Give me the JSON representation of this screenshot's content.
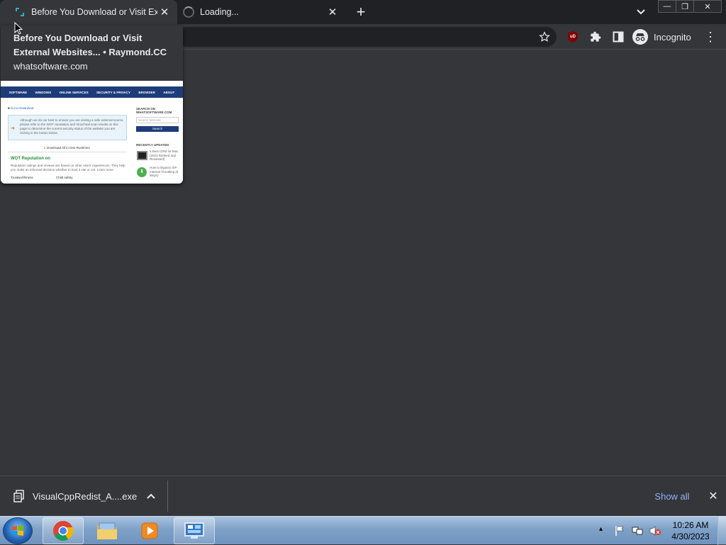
{
  "tabs": [
    {
      "title": "Before You Download or Visit External Websites... • Raymond.CC",
      "close_glyph": "✕"
    },
    {
      "title": "Loading...",
      "close_glyph": "✕"
    }
  ],
  "new_tab_glyph": "+",
  "tab_search_glyph": "⌄",
  "window_controls": {
    "minimize": "—",
    "restore": "❐",
    "close": "✕"
  },
  "toolbar": {
    "bookmark_icon": "star-icon",
    "incognito_label": "Incognito",
    "menu_glyph": "⋮",
    "ublock_label": "uD"
  },
  "hover_card": {
    "title": "Before You Download or Visit External Websites... • Raymond.CC",
    "domain": "whatsoftware.com",
    "preview": {
      "nav": [
        "SOFTWARE",
        "WINDOWS",
        "ONLINE SERVICES",
        "SECURITY & PRIVACY",
        "BROWSER",
        "ABOUT"
      ],
      "breadcrumb": "■ Go to Download",
      "note": "Although we do our best to ensure you are visiting a safe external source, please refer to the WOT reputation and VirusTotal scan results on this page to determine the current security status of the website you are visiting in the button below.",
      "download_link": "⇩ Download All in One Runtimes",
      "wot_heading": "WOT Reputation on",
      "wot_text": "Reputation ratings and reviews are based on other users' experiences. They help you make an informed decision whether to trust a site or not. Learn more",
      "row_left": "Trustworthiness",
      "row_right": "Child safety",
      "search_heading": "SEARCH ON WHATSOFTWARE.COM",
      "search_placeholder": "Search Website",
      "search_button": "Search",
      "recent_heading": "RECENTLY UPDATED",
      "recent_1": "5 Best CRM for Mac (2023 Ranked and Reviewed)",
      "recent_2": "How to Bypass ISP Internet Throttling (5 Ways)"
    }
  },
  "download_shelf": {
    "filename": "VisualCppRedist_A....exe",
    "chevron": "⌃",
    "show_all": "Show all",
    "close_glyph": "✕"
  },
  "taskbar": {
    "time": "10:26 AM",
    "date": "4/30/2023",
    "tray_arrow": "▴"
  }
}
